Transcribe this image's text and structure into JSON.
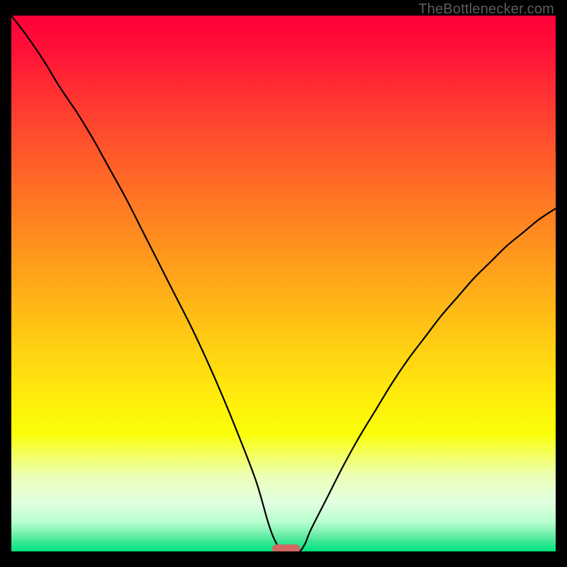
{
  "watermark": "TheBottlenecker.com",
  "chart_data": {
    "type": "line",
    "title": "",
    "xlabel": "",
    "ylabel": "",
    "xlim": [
      0,
      100
    ],
    "ylim": [
      0,
      100
    ],
    "x": [
      0,
      3,
      6,
      9,
      12,
      15,
      18,
      21,
      24,
      27,
      30,
      33,
      36,
      39,
      42,
      45,
      47,
      48,
      49,
      50,
      51,
      52,
      53,
      54,
      55,
      58,
      61,
      64,
      67,
      70,
      73,
      76,
      79,
      82,
      85,
      88,
      91,
      94,
      97,
      100
    ],
    "values": [
      100,
      96,
      91.5,
      86.5,
      82,
      77,
      71.5,
      66,
      60,
      54,
      48,
      42,
      35.5,
      28.5,
      21,
      13,
      6,
      3,
      1,
      0,
      0,
      0,
      0,
      1.5,
      4,
      10,
      16,
      21.5,
      26.5,
      31.5,
      36,
      40,
      44,
      47.5,
      51,
      54,
      57,
      59.5,
      62,
      64
    ],
    "gradient_stops": [
      {
        "offset": 0.0,
        "color": "#ff003a"
      },
      {
        "offset": 0.06,
        "color": "#ff1038"
      },
      {
        "offset": 0.14,
        "color": "#ff2f33"
      },
      {
        "offset": 0.22,
        "color": "#ff4c2d"
      },
      {
        "offset": 0.3,
        "color": "#ff6727"
      },
      {
        "offset": 0.38,
        "color": "#ff8221"
      },
      {
        "offset": 0.46,
        "color": "#ff9c1c"
      },
      {
        "offset": 0.54,
        "color": "#ffb617"
      },
      {
        "offset": 0.62,
        "color": "#ffd012"
      },
      {
        "offset": 0.7,
        "color": "#ffe80d"
      },
      {
        "offset": 0.78,
        "color": "#faff08"
      },
      {
        "offset": 0.86,
        "color": "#ecffb8"
      },
      {
        "offset": 0.91,
        "color": "#e0ffe0"
      },
      {
        "offset": 0.945,
        "color": "#b8ffd0"
      },
      {
        "offset": 0.965,
        "color": "#7cf0b0"
      },
      {
        "offset": 0.982,
        "color": "#3be695"
      },
      {
        "offset": 1.0,
        "color": "#00e27f"
      }
    ],
    "marker": {
      "x_center": 50.5,
      "y": 0.5,
      "width": 5.2,
      "height": 1.6,
      "rx": 0.9,
      "color": "#d06a62"
    },
    "curve_stroke": "#000000",
    "curve_width": 2.2
  }
}
